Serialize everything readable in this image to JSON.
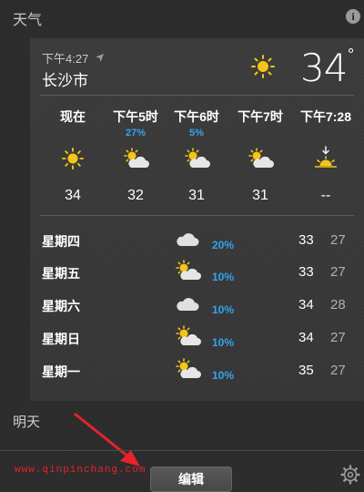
{
  "header": {
    "title": "天气",
    "info_label": "i"
  },
  "current": {
    "time": "下午4:27",
    "city": "长沙市",
    "temp": "34",
    "deg": "°",
    "icon": "sun-icon"
  },
  "hourly": [
    {
      "label": "现在",
      "precip": "",
      "icon": "sun-icon",
      "temp": "34"
    },
    {
      "label": "下午5时",
      "precip": "27%",
      "icon": "partly-cloudy-icon",
      "temp": "32"
    },
    {
      "label": "下午6时",
      "precip": "5%",
      "icon": "partly-cloudy-icon",
      "temp": "31"
    },
    {
      "label": "下午7时",
      "precip": "",
      "icon": "partly-cloudy-icon",
      "temp": "31"
    },
    {
      "label": "下午7:28",
      "precip": "",
      "icon": "sunset-icon",
      "temp": "--"
    }
  ],
  "daily": [
    {
      "day": "星期四",
      "icon": "cloud-icon",
      "precip": "20%",
      "hi": "33",
      "lo": "27"
    },
    {
      "day": "星期五",
      "icon": "partly-cloudy-icon",
      "precip": "10%",
      "hi": "33",
      "lo": "27"
    },
    {
      "day": "星期六",
      "icon": "cloud-icon",
      "precip": "10%",
      "hi": "34",
      "lo": "28"
    },
    {
      "day": "星期日",
      "icon": "partly-cloudy-icon",
      "precip": "10%",
      "hi": "34",
      "lo": "27"
    },
    {
      "day": "星期一",
      "icon": "partly-cloudy-icon",
      "precip": "10%",
      "hi": "35",
      "lo": "27"
    }
  ],
  "tomorrow_label": "明天",
  "footer": {
    "watermark": "www.qinpinchang.com",
    "edit_label": "编辑"
  },
  "colors": {
    "precip": "#35a3ee",
    "sun": "#f5c518",
    "watermark": "#e8212a"
  }
}
